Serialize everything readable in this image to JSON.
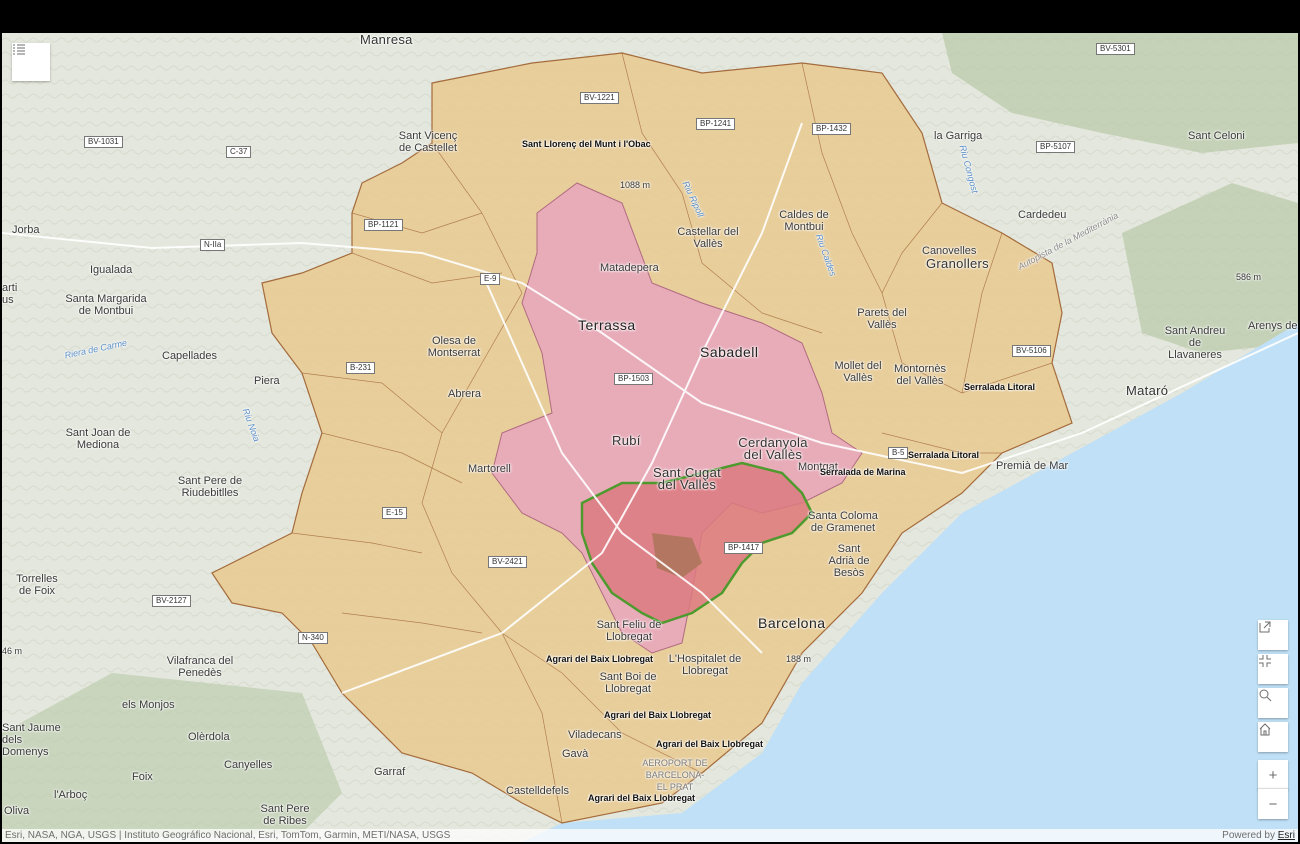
{
  "colors": {
    "water": "#bfe0f6",
    "land": "#e4e7dd",
    "municipality": "#e9c98f",
    "highlight": "#e7a6be",
    "focus": "#dc7a80",
    "focus_outline": "#4e9a2e",
    "border": "#a46b3c"
  },
  "labels": {
    "manresa": "Manresa",
    "terrassa": "Terrassa",
    "sabadell": "Sabadell",
    "rubi": "Rubí",
    "barcelona": "Barcelona",
    "mataro": "Mataró",
    "sant_cugat": "Sant Cugat del Vallès",
    "cerdanyola": "Cerdanyola del Vallès",
    "matadepera": "Matadepera",
    "castellar": "Castellar del Vallès",
    "caldes": "Caldes de Montbui",
    "granollers": "Granollers",
    "canovelles": "Canovelles",
    "parets": "Parets del Vallès",
    "mollet": "Mollet del Vallès",
    "montornes": "Montornès del Vallès",
    "santa_coloma": "Santa Coloma de Gramenet",
    "sant_adria": "Sant Adrià de Besòs",
    "montgat": "Montgat",
    "premia": "Premià de Mar",
    "hospitalet": "L'Hospitalet de Llobregat",
    "sant_boi": "Sant Boi de Llobregat",
    "sant_feliu": "Sant Feliu de Llobregat",
    "viladecans": "Viladecans",
    "gava": "Gavà",
    "castelldefels": "Castelldefels",
    "garraf": "Garraf",
    "martorell": "Martorell",
    "abrera": "Abrera",
    "olesa": "Olesa de Montserrat",
    "sant_vicenc": "Sant Vicenç de Castellet",
    "piera": "Piera",
    "capellades": "Capellades",
    "igualada": "Igualada",
    "jorba": "Jorba",
    "santa_margarida": "Santa Margarida de Montbui",
    "sant_joan_mediona": "Sant Joan de Mediona",
    "sant_pere_riudebitlles": "Sant Pere de Riudebitlles",
    "torrelles": "Torrelles de Foix",
    "vilafranca": "Vilafranca del Penedès",
    "els_monjos": "els Monjos",
    "olerdola": "Olèrdola",
    "canyelles": "Canyelles",
    "foix": "Foix",
    "arboc": "l'Arboç",
    "oliva": "Oliva",
    "sant_pere_ribes": "Sant Pere de Ribes",
    "sant_jaume": "Sant Jaume dels Domenys",
    "la_garriga": "la Garriga",
    "sant_celoni": "Sant Celoni",
    "cardedeu": "Cardedeu",
    "sant_andreu": "Sant Andreu de Llavaneres",
    "arenys": "Arenys de M",
    "aeroport": "AEROPORT DE BARCELONA-EL PRAT",
    "arti": "arti us",
    "sant_llorenc": "Sant Llorenç del Munt i l'Obac",
    "serralada_marina": "Serralada de Marina",
    "serralada_litoral_1": "Serralada Litoral",
    "serralada_litoral_2": "Serralada Litoral",
    "agrari_1": "Agrari del Baix Llobregat",
    "agrari_2": "Agrari del Baix Llobregat",
    "agrari_3": "Agrari del Baix Llobregat",
    "agrari_4": "Agrari del Baix Llobregat",
    "elev_1": "1088 m",
    "elev_2": "586 m",
    "elev_3": "188 m",
    "elev_4": "46 m",
    "riera_carme": "Riera de Carme",
    "riu_noia": "Riu Noia",
    "riu_congost": "Riu Congost",
    "riu_caldes": "Riu Caldes",
    "riu_ripoll": "Riu Ripoll",
    "autopista": "Autopista de la Mediterrània"
  },
  "road_shields": {
    "bv1221": "BV-1221",
    "bp1241": "BP-1241",
    "bp1432": "BP-1432",
    "bv5301": "BV-5301",
    "bp5107": "BP-5107",
    "bv1031": "BV-1031",
    "c37": "C-37",
    "bp1121": "BP-1121",
    "n2a": "N-IIa",
    "e9": "E-9",
    "b231": "B-231",
    "bp1503": "BP-1503",
    "e15": "E-15",
    "bv2421": "BV-2421",
    "bv2127": "BV-2127",
    "n340": "N-340",
    "bv5106": "BV-5106",
    "bp1417": "BP-1417",
    "b5": "B-5"
  },
  "controls": {
    "layer_list_icon": "list-icon",
    "expand_icon": "open-external-icon",
    "fullscreen_icon": "exit-fullscreen-icon",
    "search_icon": "search-icon",
    "home_icon": "home-icon",
    "zoom_in": "+",
    "zoom_out": "−"
  },
  "attribution": {
    "text": "Esri, NASA, NGA, USGS | Instituto Geográfico Nacional, Esri, TomTom, Garmin, METI/NASA, USGS",
    "powered_by": "Powered by ",
    "esri_link": "Esri"
  }
}
